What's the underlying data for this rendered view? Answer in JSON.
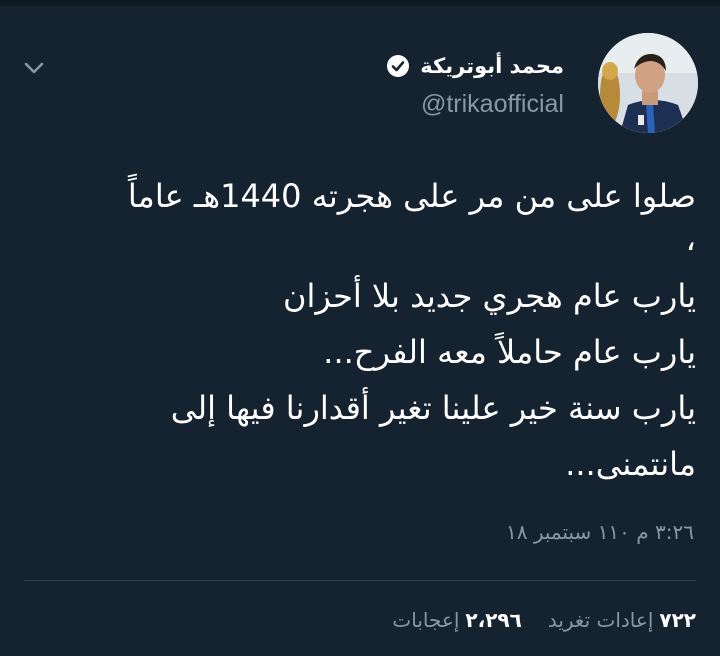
{
  "tweet": {
    "author": {
      "display_name": "محمد أبوتريكة",
      "handle": "@trikaofficial",
      "verified": true
    },
    "text_lines": [
      "صلوا على من مر على هجرته 1440هـ عاماً",
      "،",
      "يارب عام هجري جديد بلا أحزان",
      "يارب عام حاملاً معه الفرح...",
      "يارب سنة خير علينا تغير أقدارنا فيها إلى",
      "مانتمنى..."
    ],
    "timestamp": "٣:٢٦ م ١١٠ سبتمبر ١٨",
    "stats": {
      "retweets_count": "٧٢٢",
      "retweets_label": "إعادات تغريد",
      "likes_count": "٢،٢٩٦",
      "likes_label": "إعجابات"
    }
  },
  "colors": {
    "background": "#152230",
    "secondary_text": "#8899a6",
    "divider": "#38444d",
    "verified_badge": "#ffffff"
  },
  "icons": {
    "menu": "chevron-down-icon",
    "badge": "verified-badge-icon"
  }
}
